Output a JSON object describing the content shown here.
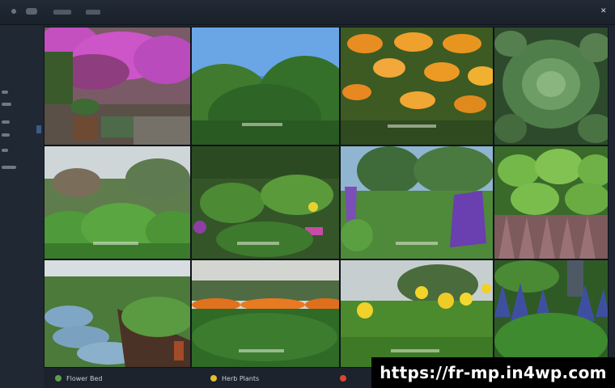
{
  "footer": {
    "items": [
      {
        "label": "Flower Bed",
        "icon": "leaf-icon",
        "color": "#5aa04a"
      },
      {
        "label": "Herb Plants",
        "icon": "sun-icon",
        "color": "#e2c12a"
      },
      {
        "label": "",
        "icon": "flower-icon",
        "color": "#d9482e"
      }
    ]
  },
  "watermark": {
    "text": "https://fr-mp.in4wp.com"
  },
  "tiles": [
    {
      "name": "tile-bougainvillea-wall"
    },
    {
      "name": "tile-green-shrubs"
    },
    {
      "name": "tile-orange-marigolds"
    },
    {
      "name": "tile-succulent-leaves"
    },
    {
      "name": "tile-hosta-leaves"
    },
    {
      "name": "tile-mixed-bed"
    },
    {
      "name": "tile-purple-salvia"
    },
    {
      "name": "tile-lettuce-heads"
    },
    {
      "name": "tile-blue-fescue-bed"
    },
    {
      "name": "tile-orange-flower-hedge"
    },
    {
      "name": "tile-yellow-blooms"
    },
    {
      "name": "tile-purple-spikes"
    }
  ]
}
